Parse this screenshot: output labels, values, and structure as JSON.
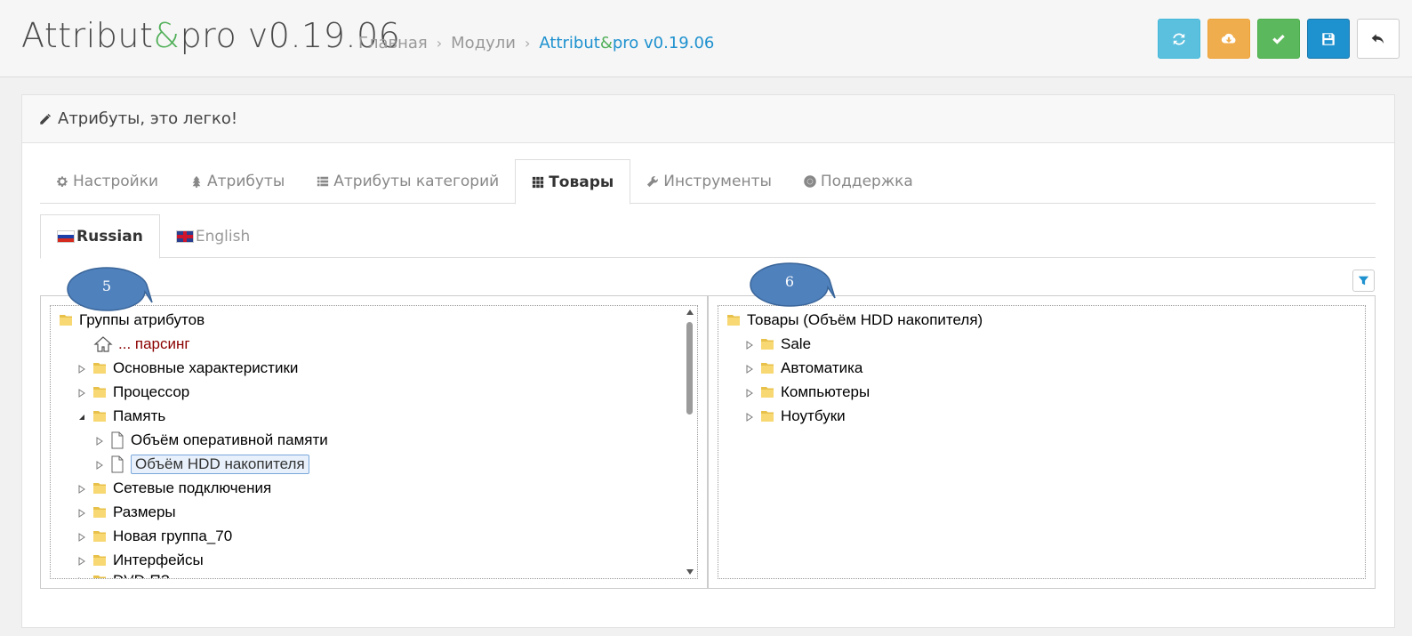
{
  "header": {
    "title_pre": "Attribut",
    "title_amp": "&",
    "title_post": "pro v0.19.06",
    "breadcrumb": {
      "home": "Главная",
      "modules": "Модули",
      "current_pre": "Attribut",
      "current_amp": "&",
      "current_post": "pro v0.19.06"
    },
    "buttons": [
      {
        "name": "refresh",
        "color": "#5bc0de"
      },
      {
        "name": "cloud-download",
        "color": "#f0ad4e"
      },
      {
        "name": "apply",
        "color": "#5cb85c"
      },
      {
        "name": "save",
        "color": "#1e91cf"
      },
      {
        "name": "back",
        "color": "#ffffff"
      }
    ]
  },
  "panel": {
    "heading": "Атрибуты, это легко!"
  },
  "tabs": [
    {
      "label": "Настройки",
      "icon": "gear-icon"
    },
    {
      "label": "Атрибуты",
      "icon": "tree-icon"
    },
    {
      "label": "Атрибуты категорий",
      "icon": "list-icon"
    },
    {
      "label": "Товары",
      "icon": "grid-icon",
      "active": true
    },
    {
      "label": "Инструменты",
      "icon": "wrench-icon"
    },
    {
      "label": "Поддержка",
      "icon": "lifering-icon"
    }
  ],
  "languages": [
    {
      "label": "Russian",
      "active": true
    },
    {
      "label": "English"
    }
  ],
  "left_tree": {
    "root": "Группы атрибутов",
    "items": [
      {
        "label": "... парсинг"
      },
      {
        "label": "Основные характеристики"
      },
      {
        "label": "Процессор"
      },
      {
        "label": "Память"
      },
      {
        "label": "Объём оперативной памяти"
      },
      {
        "label": "Объём HDD накопителя"
      },
      {
        "label": "Сетевые подключения"
      },
      {
        "label": "Размеры"
      },
      {
        "label": "Новая группа_70"
      },
      {
        "label": "Интерфейсы"
      },
      {
        "label": "DVD-ПЗ"
      }
    ]
  },
  "right_tree": {
    "root": "Товары (Объём HDD накопителя)",
    "items": [
      {
        "label": "Sale"
      },
      {
        "label": "Автоматика"
      },
      {
        "label": "Компьютеры"
      },
      {
        "label": "Ноутбуки"
      }
    ]
  },
  "callouts": {
    "left": "5",
    "right": "6",
    "color": "#4f81bd"
  }
}
